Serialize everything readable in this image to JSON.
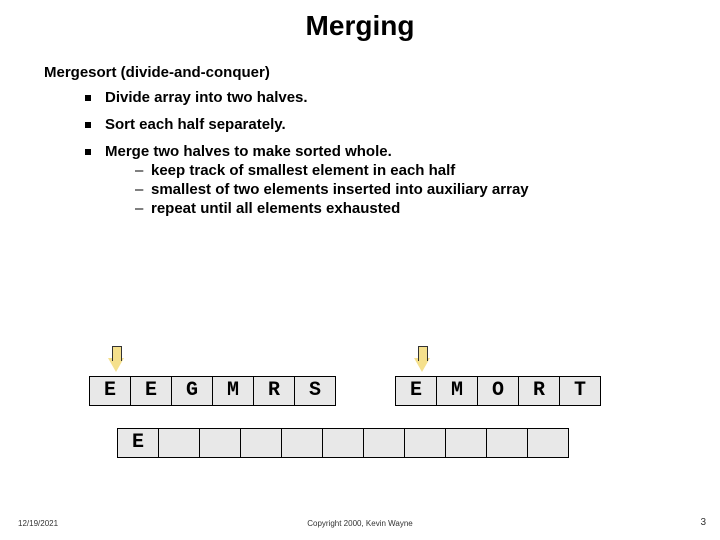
{
  "title": "Merging",
  "subtitle": "Mergesort  (divide-and-conquer)",
  "bullets": {
    "b1": "Divide array into two halves.",
    "b2": "Sort each half separately.",
    "b3": "Merge two halves to make sorted whole.",
    "s1": "keep track of smallest element in each half",
    "s2": "smallest of two elements inserted into auxiliary array",
    "s3": "repeat until all elements exhausted"
  },
  "arrays": {
    "left": [
      "E",
      "E",
      "G",
      "M",
      "R",
      "S"
    ],
    "right": [
      "E",
      "M",
      "O",
      "R",
      "T"
    ],
    "aux": [
      "E",
      "",
      "",
      "",
      "",
      "",
      "",
      "",
      "",
      "",
      ""
    ]
  },
  "footer": {
    "date": "12/19/2021",
    "copyright": "Copyright 2000, Kevin Wayne",
    "page": "3"
  }
}
